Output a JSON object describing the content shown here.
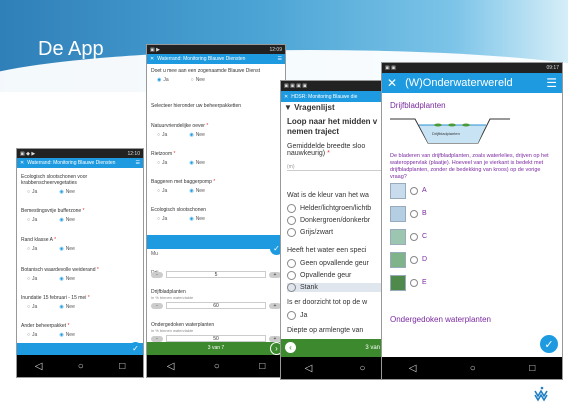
{
  "slide": {
    "title": "De App"
  },
  "phone1": {
    "status_time": "12:10",
    "appbar_title": "Waterrand: Monitoring Blauwe Diensten",
    "questions": [
      {
        "label": "Ecologisch slootschonen voor krabbenscheervegetaties",
        "required": false,
        "yes": "Ja",
        "no": "Nee"
      },
      {
        "label": "Bemestingsvrije bufferzone",
        "required": true,
        "yes": "Ja",
        "no": "Nee"
      },
      {
        "label": "Rand klasse A",
        "required": true,
        "yes": "Ja",
        "no": "Nee"
      },
      {
        "label": "Botanisch waardevolle weiderand",
        "required": true,
        "yes": "Ja",
        "no": "Nee"
      },
      {
        "label": "Inundatie 15 februari - 15 mei",
        "required": true,
        "yes": "Ja",
        "no": "Nee"
      },
      {
        "label": "Ander beheerpakket",
        "required": true,
        "yes": "Ja",
        "no": "Nee"
      }
    ]
  },
  "phone2": {
    "status_time": "12:09",
    "appbar_title": "Waterrand: Monitoring Blauwe Diensten",
    "questions": [
      {
        "label": "Doet u mee aan een zogenaamde Blauwe Dienst",
        "required": false,
        "yes": "Ja",
        "no": "Nee"
      },
      {
        "label": "Selecteer hieronder uw beheerpakketten",
        "required": false
      },
      {
        "label": "Natuurvriendelijke oever",
        "required": true,
        "yes": "Ja",
        "no": "Nee"
      },
      {
        "label": "Rietzoom",
        "required": true,
        "yes": "Ja",
        "no": "Nee"
      },
      {
        "label": "Baggeren met baggerpomp",
        "required": true,
        "yes": "Ja",
        "no": "Nee"
      },
      {
        "label": "Ecologisch slootschonen",
        "required": false,
        "yes": "Ja",
        "no": "Nee"
      }
    ],
    "peek_labels": [
      "Mu",
      "Drij",
      "Ond"
    ],
    "stepper1": {
      "value": "5",
      "minus": "-",
      "plus": "+"
    },
    "drijfblad_label": "Drijfbladplanten",
    "drijfblad_hint": "in % binnen watervlakte",
    "stepper2": {
      "value": "60",
      "minus": "-",
      "plus": "+"
    },
    "onder_label": "Ondergedoken waterplanten",
    "onder_hint": "in % binnen watervlakte",
    "stepper3": {
      "value": "50",
      "minus": "-",
      "plus": "+"
    },
    "pager": "3 van 7"
  },
  "phone3": {
    "appbar_title": "HDSR: Monitoring Blauwe die",
    "section_title": "Vragenlijst",
    "heading": "Loop naar het midden v nemen traject",
    "q1_label": "Gemiddelde breedte sloo nauwkeurig)",
    "q1_placeholder": "(m)",
    "q2_label": "Wat is de kleur van het wa",
    "q2_options": [
      "Helder/lichtgroen/lichtb",
      "Donkergroen/donkerbr",
      "Grijs/zwart"
    ],
    "q3_label": "Heeft het water een speci",
    "q3_options": [
      "Geen opvallende geur",
      "Opvallende geur",
      "Stank"
    ],
    "q4_label": "Is er doorzicht tot op de w",
    "q4_yes": "Ja",
    "q5_label": "Diepte op armlengte van",
    "pager": "3 van 6"
  },
  "phone4": {
    "status_time": "09:17",
    "title": "(W)Onderwaterwereld",
    "section1": "Drijfbladplanten",
    "diagram_caption": "Drijfbladplanten",
    "description": "De bladeren van drijfbladplanten, zoals waterlelies, drijven op het wateroppervlak (plaatje). Hoeveel van je vierkant is bedekt met drijfbladplanten, zonder de bedekking van kroos) op de vorige vraag?",
    "options": [
      "A",
      "B",
      "C",
      "D",
      "E"
    ],
    "section2": "Ondergedoken waterplanten"
  },
  "nav": {
    "back": "◁",
    "home": "○",
    "recent": "□"
  },
  "colors": {
    "accent": "#1e9be0",
    "title_purple": "#7a2aa0",
    "bottom_green": "#3d8a2e"
  },
  "icons": [
    "close-icon",
    "menu-icon",
    "check-icon",
    "arrow-left-icon",
    "arrow-right-icon",
    "logo-icon"
  ]
}
